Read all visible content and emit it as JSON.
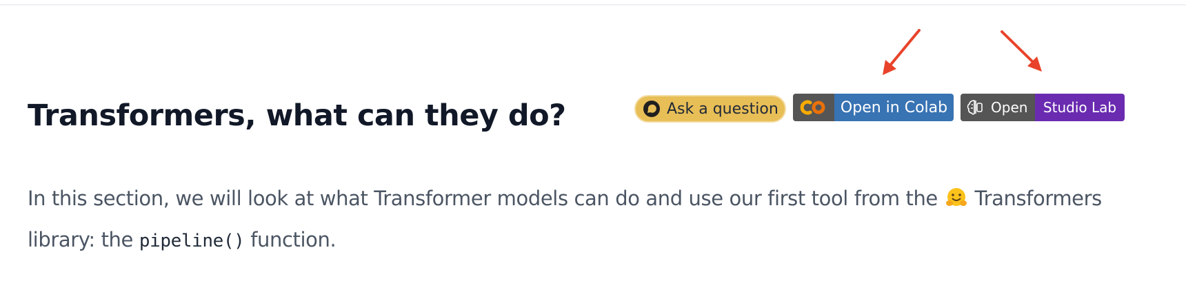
{
  "title": "Transformers, what can they do?",
  "badges": {
    "ask_label": "Ask a question",
    "colab_label": "Open in Colab",
    "studio_left_label": "Open",
    "studio_right_label": "Studio Lab"
  },
  "intro": {
    "before_emoji": "In this section, we will look at what Transformer models can do and use our first tool from the",
    "emoji_name": "hugging-face-emoji",
    "after_emoji": "Transformers library: the",
    "code": "pipeline()",
    "after_code": "function."
  },
  "colors": {
    "arrow": "#e8432a",
    "ask_bg": "#e8be57",
    "colab_blue": "#3873b3",
    "studio_purple": "#6a2bb0",
    "badge_gray": "#555555"
  }
}
